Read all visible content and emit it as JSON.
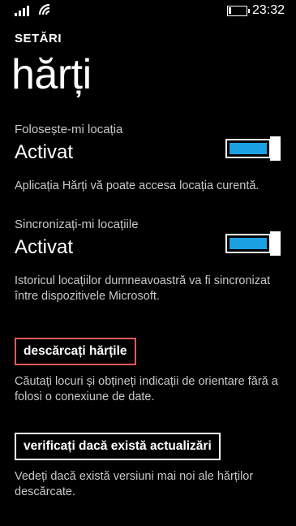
{
  "status_bar": {
    "time": "23:32",
    "battery_level": 0.12
  },
  "header": {
    "app_title": "SETĂRI",
    "page_title": "hărți"
  },
  "settings": [
    {
      "label": "Folosește-mi locația",
      "state": "Activat",
      "enabled": true,
      "description": "Aplicația Hărți vă poate accesa locația curentă."
    },
    {
      "label": "Sincronizați-mi locațiile",
      "state": "Activat",
      "enabled": true,
      "description": "Istoricul locațiilor dumneavoastră va fi sincronizat între dispozitivele Microsoft."
    }
  ],
  "actions": [
    {
      "label": "descărcați hărțile",
      "highlight_color": "#e05a5a",
      "description": "Căutați locuri și obțineți indicații de orientare fără a folosi o conexiune de date."
    },
    {
      "label": "verificați dacă există actualizări",
      "description": "Vedeți dacă există versiuni mai noi ale hărților descărcate."
    }
  ],
  "colors": {
    "accent": "#1ba1e2",
    "background": "#000000",
    "text": "#ffffff"
  }
}
